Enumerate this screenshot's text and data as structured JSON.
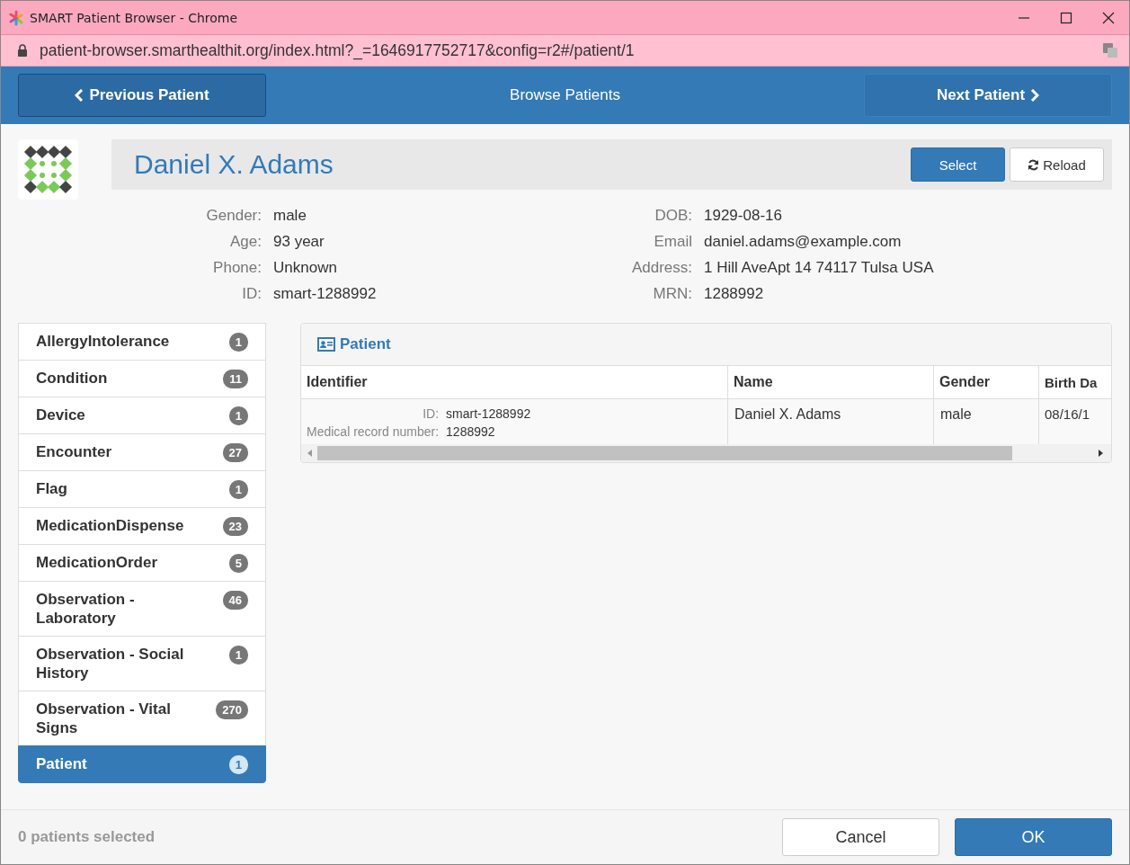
{
  "window": {
    "title": "SMART Patient Browser - Chrome"
  },
  "address_bar": {
    "url": "patient-browser.smarthealthit.org/index.html?_=1646917752717&config=r2#/patient/1"
  },
  "nav": {
    "previous": "Previous Patient",
    "title": "Browse Patients",
    "next": "Next Patient"
  },
  "patient": {
    "name": "Daniel X. Adams",
    "select": "Select",
    "reload": "Reload"
  },
  "details": [
    {
      "label": "Gender:",
      "value": "male"
    },
    {
      "label": "DOB:",
      "value": "1929-08-16"
    },
    {
      "label": "Age:",
      "value": "93 year"
    },
    {
      "label": "Email",
      "value": "daniel.adams@example.com"
    },
    {
      "label": "Phone:",
      "value": "Unknown"
    },
    {
      "label": "Address:",
      "value": "1 Hill AveApt 14 74117 Tulsa USA"
    },
    {
      "label": "ID:",
      "value": "smart-1288992"
    },
    {
      "label": "MRN:",
      "value": "1288992"
    }
  ],
  "sidebar": {
    "items": [
      {
        "label": "AllergyIntolerance",
        "count": "1",
        "selected": false
      },
      {
        "label": "Condition",
        "count": "11",
        "selected": false
      },
      {
        "label": "Device",
        "count": "1",
        "selected": false
      },
      {
        "label": "Encounter",
        "count": "27",
        "selected": false
      },
      {
        "label": "Flag",
        "count": "1",
        "selected": false
      },
      {
        "label": "MedicationDispense",
        "count": "23",
        "selected": false
      },
      {
        "label": "MedicationOrder",
        "count": "5",
        "selected": false
      },
      {
        "label": "Observation - Laboratory",
        "count": "46",
        "selected": false
      },
      {
        "label": "Observation - Social History",
        "count": "1",
        "selected": false
      },
      {
        "label": "Observation - Vital Signs",
        "count": "270",
        "selected": false
      },
      {
        "label": "Patient",
        "count": "1",
        "selected": true
      }
    ]
  },
  "panel": {
    "title": "Patient",
    "table": {
      "columns": [
        "Identifier",
        "Name",
        "Gender",
        "Birth Da"
      ],
      "rows": [
        {
          "identifier": [
            {
              "label": "ID:",
              "value": "smart-1288992"
            },
            {
              "label": "Medical record number:",
              "value": "1288992"
            }
          ],
          "name": "Daniel X. Adams",
          "gender": "male",
          "birth_date": "08/16/1"
        }
      ]
    }
  },
  "footer": {
    "status": "0 patients selected",
    "cancel": "Cancel",
    "ok": "OK"
  }
}
